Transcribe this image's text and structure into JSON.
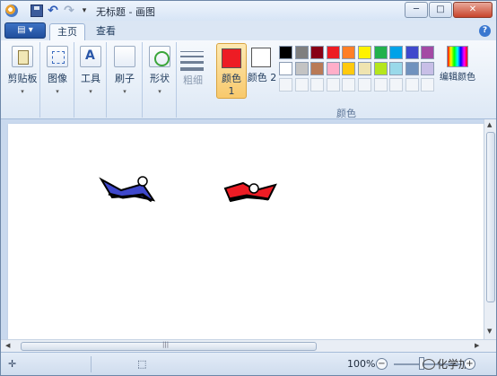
{
  "titlebar": {
    "title": "无标题 - 画图",
    "minimize": "─",
    "maximize": "□",
    "close": "✕"
  },
  "tabs": {
    "menu_label": "▤ ▾",
    "items": [
      "主页",
      "查看"
    ],
    "help": "?"
  },
  "ribbon": {
    "clipboard": "剪贴板",
    "image": "图像",
    "tools": "工具",
    "brushes": "刷子",
    "shapes": "形状",
    "size": "粗细",
    "color1": "颜色 1",
    "color2": "颜色 2",
    "edit_colors": "编辑颜色",
    "colors_group": "颜色",
    "dropdown_arrow": "▾"
  },
  "colors": {
    "color1": "#ed1c24",
    "color2": "#ffffff",
    "palette_row1": [
      "#000000",
      "#7f7f7f",
      "#880015",
      "#ed1c24",
      "#ff7f27",
      "#fff200",
      "#22b14c",
      "#00a2e8",
      "#3f48cc",
      "#a349a4"
    ],
    "palette_row2": [
      "#ffffff",
      "#c3c3c3",
      "#b97a57",
      "#ffaec9",
      "#ffc90e",
      "#efe4b0",
      "#b5e61d",
      "#99d9ea",
      "#7092be",
      "#c8bfe7"
    ]
  },
  "status": {
    "zoom": "100%",
    "zoom_out": "−",
    "zoom_in": "+",
    "watermark": "化学加"
  }
}
